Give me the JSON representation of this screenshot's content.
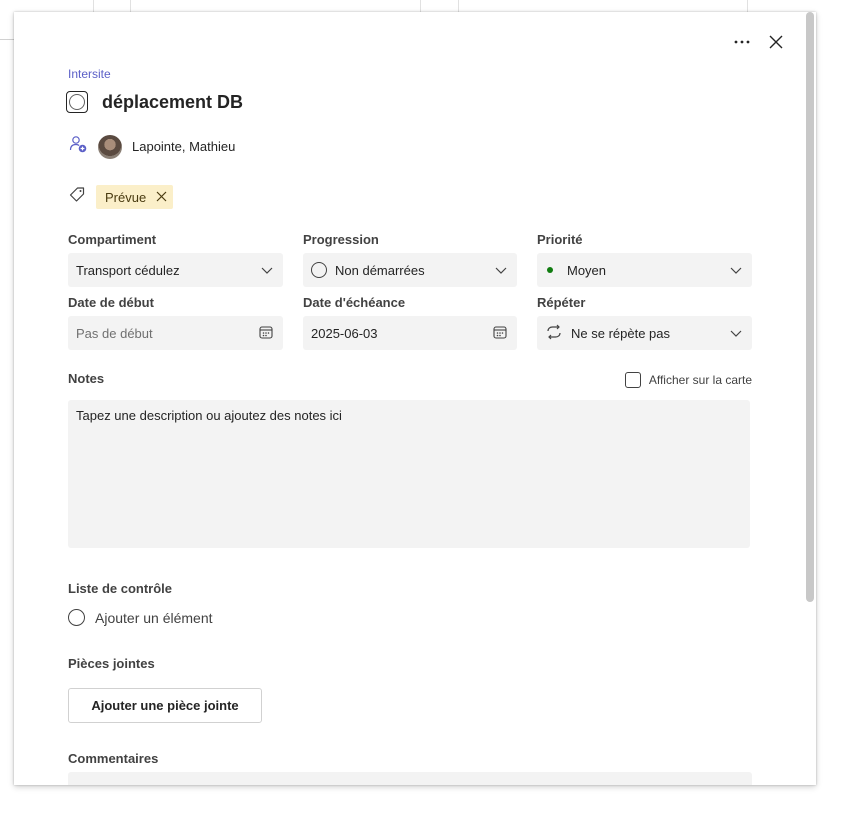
{
  "task": {
    "bucket_link": "Intersite",
    "title": "déplacement DB",
    "assignee": "Lapointe, Mathieu",
    "label": "Prévue"
  },
  "fields": {
    "bucket": {
      "label": "Compartiment",
      "value": "Transport cédulez"
    },
    "progress": {
      "label": "Progression",
      "value": "Non démarrées"
    },
    "priority": {
      "label": "Priorité",
      "value": "Moyen"
    },
    "start_date": {
      "label": "Date de début",
      "placeholder": "Pas de début"
    },
    "due_date": {
      "label": "Date d'échéance",
      "value": "2025-06-03"
    },
    "repeat": {
      "label": "Répéter",
      "value": "Ne se répète pas"
    }
  },
  "notes": {
    "label": "Notes",
    "show_on_card": "Afficher sur la carte",
    "placeholder": "Tapez une description ou ajoutez des notes ici"
  },
  "checklist": {
    "label": "Liste de contrôle",
    "add_item": "Ajouter un élément"
  },
  "attachments": {
    "label": "Pièces jointes",
    "add_button": "Ajouter une pièce jointe"
  },
  "comments": {
    "label": "Commentaires"
  },
  "colors": {
    "accent": "#5b5fc7",
    "label_chip": "#fbefc9",
    "priority_dot": "#107c10",
    "field_bg": "#f3f3f3"
  },
  "icons": [
    "more-icon",
    "close-icon",
    "assign-person-icon",
    "tag-icon",
    "chevron-down-icon",
    "calendar-icon",
    "repeat-icon"
  ]
}
